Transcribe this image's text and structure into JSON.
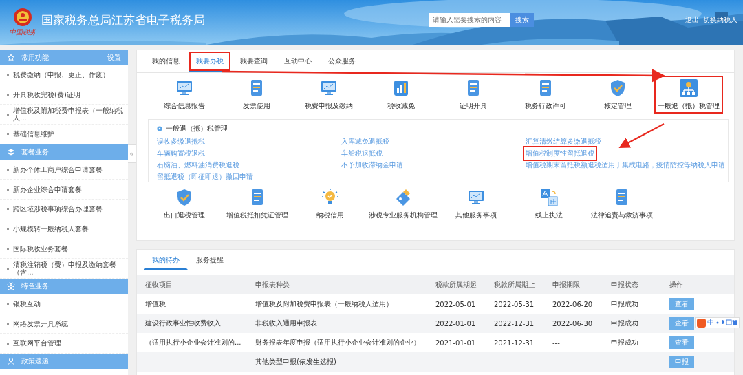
{
  "header": {
    "logo_caption": "中国税务",
    "title": "国家税务总局江苏省电子税务局",
    "search": {
      "placeholder": "请输入需要搜索的内容",
      "button": "搜索"
    },
    "links": [
      "退出",
      "切换纳税人"
    ]
  },
  "sidebar": {
    "sections": [
      {
        "kind": "star",
        "title": "常用功能",
        "action": "设置",
        "items": [
          "税费缴纳（申报、更正、作废）",
          "开具税收完税(费)证明",
          "增值税及附加税费申报表（一般纳税人...",
          "基础信息维护"
        ]
      },
      {
        "kind": "stack",
        "title": "套餐业务",
        "items": [
          "新办个体工商户综合申请套餐",
          "新办企业综合申请套餐",
          "跨区域涉税事项综合办理套餐",
          "小规模转一般纳税人套餐",
          "国际税收业务套餐",
          "清税注销税（费）申报及缴纳套餐（含..."
        ]
      },
      {
        "kind": "grid",
        "title": "特色业务",
        "items": [
          "银税互动",
          "网络发票开具系统",
          "互联网平台管理"
        ]
      },
      {
        "kind": "person",
        "title": "政策速递"
      }
    ],
    "collapse": "«"
  },
  "main": {
    "tabs": [
      {
        "label": "我的信息",
        "selected": false,
        "highlighted": false
      },
      {
        "label": "我要办税",
        "selected": true,
        "highlighted": true
      },
      {
        "label": "我要查询",
        "selected": false,
        "highlighted": false
      },
      {
        "label": "互动中心",
        "selected": false,
        "highlighted": false
      },
      {
        "label": "公众服务",
        "selected": false,
        "highlighted": false
      }
    ],
    "services": [
      {
        "kind": "monitor",
        "label": "综合信息报告",
        "selected": false,
        "highlighted": false
      },
      {
        "kind": "doc",
        "label": "发票使用",
        "selected": false,
        "highlighted": false
      },
      {
        "kind": "monitor",
        "label": "税费申报及缴纳",
        "selected": false,
        "highlighted": false
      },
      {
        "kind": "chart",
        "label": "税收减免",
        "selected": false,
        "highlighted": false
      },
      {
        "kind": "doc",
        "label": "证明开具",
        "selected": false,
        "highlighted": false
      },
      {
        "kind": "doc",
        "label": "税务行政许可",
        "selected": false,
        "highlighted": false
      },
      {
        "kind": "shield",
        "label": "核定管理",
        "selected": false,
        "highlighted": false
      },
      {
        "kind": "org",
        "label": "一般退（抵）税管理",
        "selected": true,
        "highlighted": true
      }
    ],
    "submenu": {
      "title": "一般退（抵）税管理",
      "links": [
        {
          "label": "误收多缴退抵税",
          "highlighted": false
        },
        {
          "label": "入库减免退抵税",
          "highlighted": false
        },
        {
          "label": "汇算清缴结算多缴退抵税",
          "highlighted": false
        },
        {
          "label": "车辆购置税退税",
          "highlighted": false
        },
        {
          "label": "车船税退抵税",
          "highlighted": false
        },
        {
          "label": "增值税制度性留抵退税",
          "highlighted": true
        },
        {
          "label": "石脑油、燃料油消费税退税",
          "highlighted": false
        },
        {
          "label": "不予加收滞纳金申请",
          "highlighted": false
        },
        {
          "label": "增值税期末留抵税额退税适用于集成电路，疫情防控等纳税人申请",
          "highlighted": false
        },
        {
          "label": "留抵退税（即征即退）撤回申请",
          "highlighted": false
        }
      ]
    },
    "services_2": [
      {
        "kind": "shield",
        "label": "出口退税管理",
        "selected": false,
        "highlighted": false
      },
      {
        "kind": "doc",
        "label": "增值税抵扣凭证管理",
        "selected": false,
        "highlighted": false
      },
      {
        "kind": "bulb",
        "label": "纳税信用",
        "selected": false,
        "highlighted": false
      },
      {
        "kind": "tag",
        "label": "涉税专业服务机构管理",
        "selected": false,
        "highlighted": false
      },
      {
        "kind": "monitor",
        "label": "其他服务事项",
        "selected": false,
        "highlighted": false
      },
      {
        "kind": "translate",
        "label": "线上执法",
        "selected": false,
        "highlighted": false
      },
      {
        "kind": "doc",
        "label": "法律追责与救济事项",
        "selected": false,
        "highlighted": false
      }
    ]
  },
  "todo": {
    "tabs": [
      {
        "label": "我的待办",
        "selected": true
      },
      {
        "label": "服务提醒",
        "selected": false
      }
    ],
    "table": {
      "columns": [
        "征收项目",
        "申报表种类",
        "税款所属期起",
        "税款所属期止",
        "申报期限",
        "申报状态",
        "操作"
      ],
      "rows": [
        {
          "cells": [
            "增值税",
            "增值税及附加税费申报表（一般纳税人适用）",
            "2022-05-01",
            "2022-05-31",
            "2022-06-20",
            "申报成功"
          ],
          "action": "查看"
        },
        {
          "cells": [
            "建设行政事业性收费收入",
            "非税收入通用申报表",
            "2022-01-01",
            "2022-12-31",
            "2022-06-30",
            "申报成功"
          ],
          "action": "查看"
        },
        {
          "cells": [
            "（适用执行小企业会计准则的...",
            "财务报表年度申报（适用执行小企业会计准则的企业）",
            "2021-01-01",
            "2021-12-31",
            "---",
            "申报成功"
          ],
          "action": "查看"
        },
        {
          "cells": [
            "---",
            "其他类型申报(依发生选报)",
            "---",
            "---",
            "---",
            "---"
          ],
          "action": "申报"
        }
      ]
    }
  },
  "ime_toolbar": {
    "mode": "中"
  }
}
